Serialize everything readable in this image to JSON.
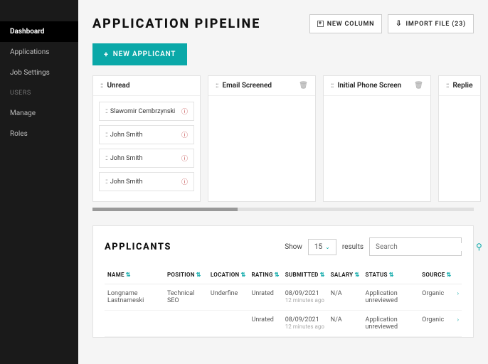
{
  "sidebar": {
    "items": [
      {
        "label": "Dashboard",
        "active": true
      },
      {
        "label": "Applications"
      },
      {
        "label": "Job Settings"
      }
    ],
    "group_label": "USERS",
    "group_items": [
      {
        "label": "Manage"
      },
      {
        "label": "Roles"
      }
    ]
  },
  "header": {
    "title": "APPLICATION PIPELINE",
    "new_column": "NEW COLUMN",
    "import_file": "IMPORT FILE (23)",
    "new_applicant": "NEW APPLICANT"
  },
  "columns": [
    {
      "title": "Unread",
      "cards": [
        "Slawomir Cembrzynski",
        "John Smith",
        "John Smith",
        "John Smith"
      ],
      "trash": false
    },
    {
      "title": "Email Screened",
      "cards": [],
      "trash": true
    },
    {
      "title": "Initial Phone Screen",
      "cards": [],
      "trash": true
    },
    {
      "title": "Replied",
      "cards": [],
      "trash": true
    }
  ],
  "applicants": {
    "title": "APPLICANTS",
    "show_label": "Show",
    "results_label": "results",
    "page_size": "15",
    "search_placeholder": "Search",
    "headers": [
      "NAME",
      "POSITION",
      "LOCATION",
      "RATING",
      "SUBMITTED",
      "SALARY",
      "STATUS",
      "SOURCE"
    ],
    "rows": [
      {
        "name": "Longname Lastnameski",
        "position": "Technical SEO",
        "location": "Underfine",
        "rating": "Unrated",
        "submitted": "08/09/2021",
        "submitted_sub": "12 minutes ago",
        "salary": "N/A",
        "status": "Application unreviewed",
        "source": "Organic"
      },
      {
        "name": "",
        "position": "",
        "location": "",
        "rating": "Unrated",
        "submitted": "08/09/2021",
        "submitted_sub": "12 minutes ago",
        "salary": "N/A",
        "status": "Application unreviewed",
        "source": "Organic"
      }
    ]
  }
}
